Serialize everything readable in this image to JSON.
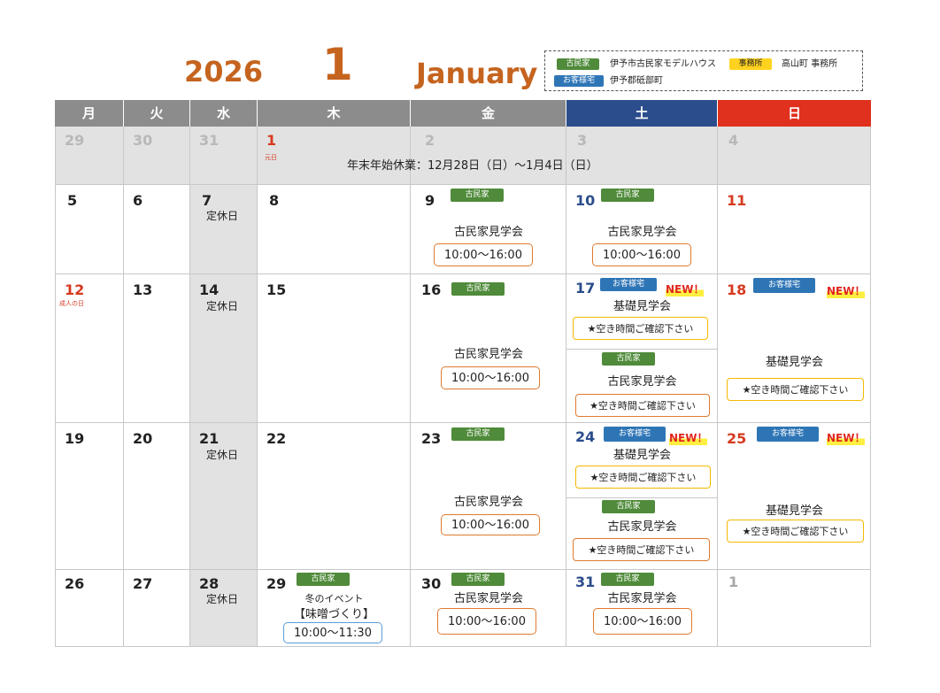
{
  "header": {
    "year": "2026",
    "month_num": "1",
    "month_name": "January"
  },
  "legend": {
    "kominka_badge": "古民家",
    "kominka_text": "伊予市古民家モデルハウス",
    "office_badge": "事務所",
    "office_text": "高山町 事務所",
    "customer_badge": "お客様宅",
    "customer_text": "伊予郡砥部町"
  },
  "weekdays": [
    "月",
    "火",
    "水",
    "木",
    "金",
    "土",
    "日"
  ],
  "colors": {
    "header_grey": "#8c8c8c",
    "saturday": "#2b4d8c",
    "sunday": "#e0301e",
    "accent": "#c5641f"
  },
  "week1": {
    "days": [
      "29",
      "30",
      "31",
      "1",
      "2",
      "3",
      "4"
    ],
    "holiday_label": "元日",
    "note": "年末年始休業：12月28日（日）～1月4日（日）"
  },
  "week2": {
    "days": [
      "5",
      "6",
      "7",
      "8",
      "9",
      "10",
      "11"
    ]
  },
  "week3": {
    "days": [
      "12",
      "13",
      "14",
      "15",
      "16",
      "17",
      "18"
    ],
    "holiday_label": "成人の日"
  },
  "week4": {
    "days": [
      "19",
      "20",
      "21",
      "22",
      "23",
      "24",
      "25"
    ]
  },
  "week5": {
    "days": [
      "26",
      "27",
      "28",
      "29",
      "30",
      "31",
      "1"
    ]
  },
  "labels": {
    "closed": "定休日",
    "kominka": "古民家",
    "customer": "お客様宅",
    "kengaku": "古民家見学会",
    "kiso": "基礎見学会",
    "time_std": "10:00～16:00",
    "available": "★空き時間ご確認下さい",
    "new": "NEW！",
    "winter_event": "冬のイベント",
    "miso": "【味噌づくり】",
    "time_event": "10:00～11:30"
  }
}
